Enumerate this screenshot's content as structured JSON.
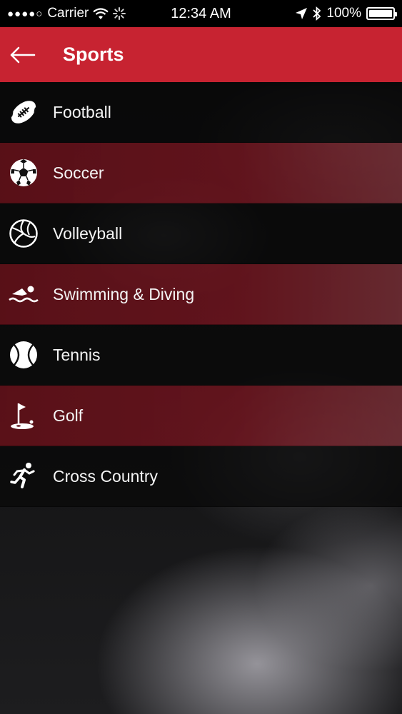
{
  "status_bar": {
    "signal": "●●●●○",
    "carrier": "Carrier",
    "time": "12:34 AM",
    "battery": "100%"
  },
  "header": {
    "title": "Sports",
    "back_icon": "arrow-left-icon",
    "background": "#c72331"
  },
  "sports": [
    {
      "label": "Football",
      "icon": "football-icon",
      "style": "dark"
    },
    {
      "label": "Soccer",
      "icon": "soccer-ball-icon",
      "style": "red"
    },
    {
      "label": "Volleyball",
      "icon": "volleyball-icon",
      "style": "dark"
    },
    {
      "label": "Swimming & Diving",
      "icon": "swimmer-icon",
      "style": "red"
    },
    {
      "label": "Tennis",
      "icon": "tennis-ball-icon",
      "style": "dark"
    },
    {
      "label": "Golf",
      "icon": "golf-flag-icon",
      "style": "red"
    },
    {
      "label": "Cross Country",
      "icon": "runner-icon",
      "style": "dark"
    }
  ]
}
